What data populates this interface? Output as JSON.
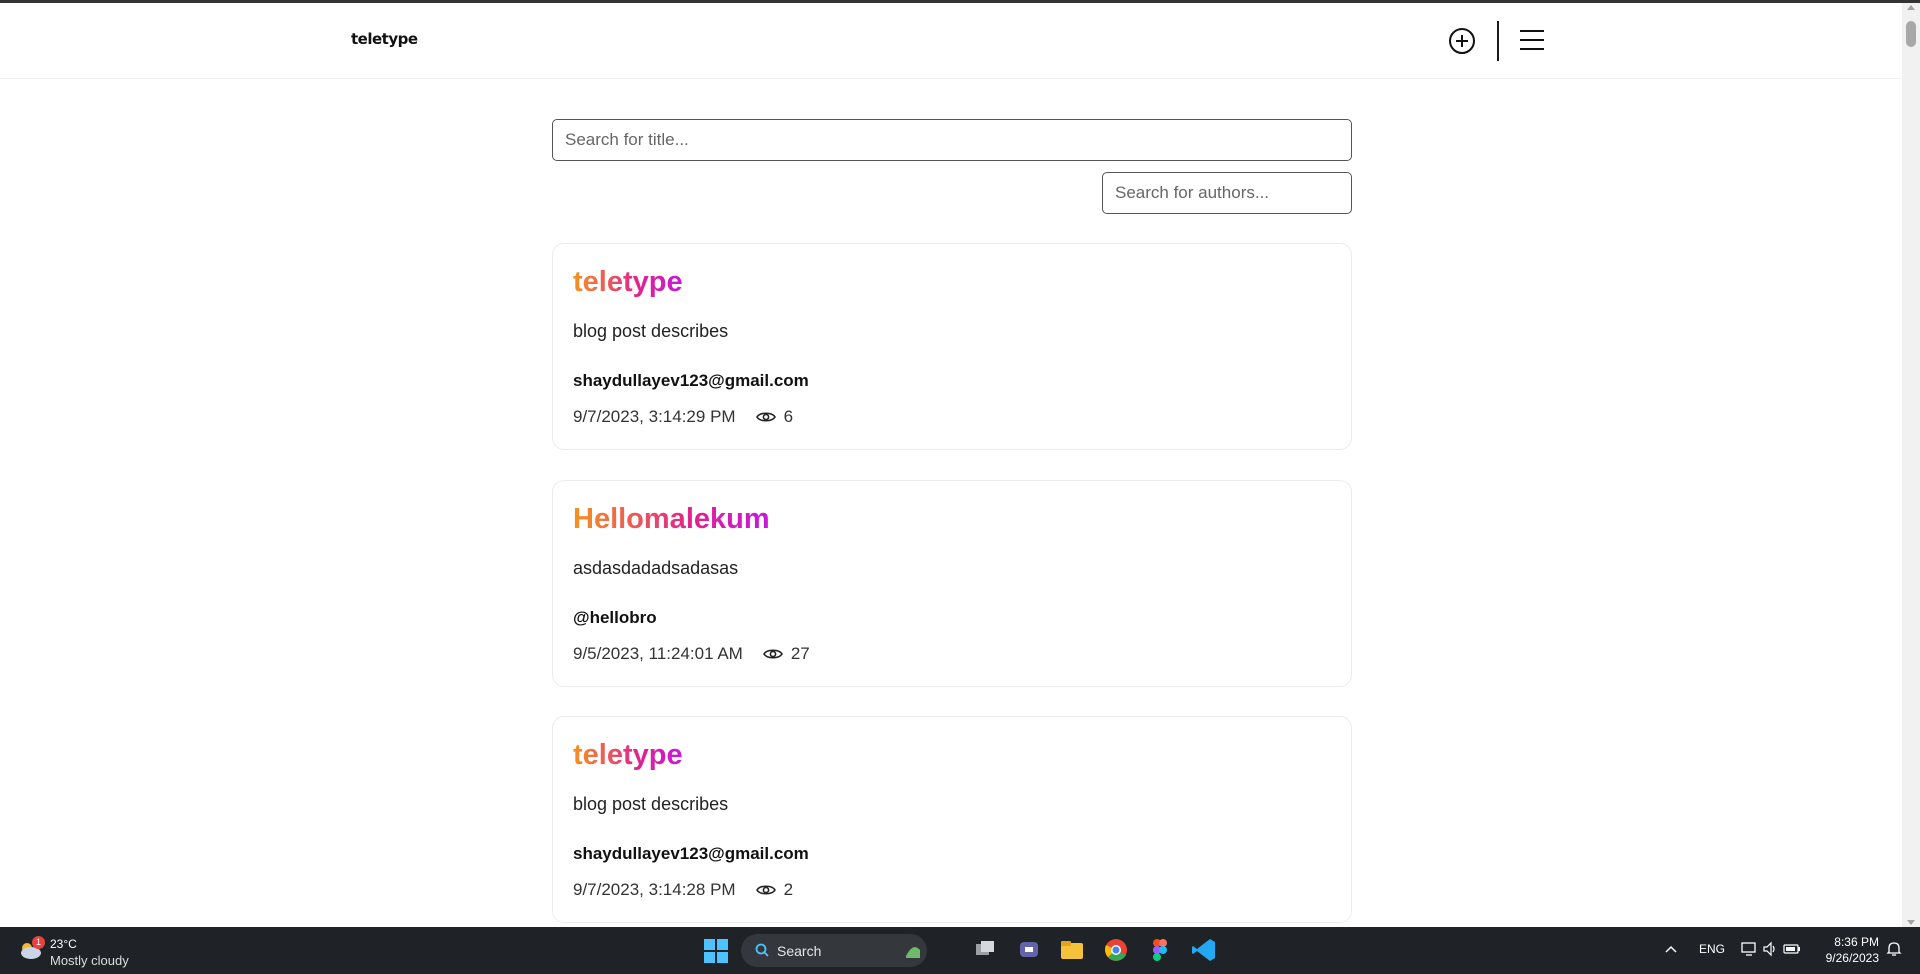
{
  "app": {
    "logo": "teletype"
  },
  "search": {
    "title_placeholder": "Search for title...",
    "authors_placeholder": "Search for authors..."
  },
  "posts": [
    {
      "title": "teletype",
      "description": "blog post describes",
      "author": "shaydullayev123@gmail.com",
      "date": "9/7/2023, 3:14:29 PM",
      "views": "6"
    },
    {
      "title": "Hellomalekum",
      "description": "asdasdadadsadasas",
      "author": "@hellobro",
      "date": "9/5/2023, 11:24:01 AM",
      "views": "27"
    },
    {
      "title": "teletype",
      "description": "blog post describes",
      "author": "shaydullayev123@gmail.com",
      "date": "9/7/2023, 3:14:28 PM",
      "views": "2"
    }
  ],
  "colors": {
    "title_gradient_start": "#f7931e",
    "title_gradient_mid": "#e0238f",
    "title_gradient_end": "#c817e0"
  },
  "taskbar": {
    "weather_badge": "1",
    "weather_temp": "23°C",
    "weather_desc": "Mostly cloudy",
    "search_label": "Search",
    "lang": "ENG",
    "time": "8:36 PM",
    "date": "9/26/2023"
  }
}
